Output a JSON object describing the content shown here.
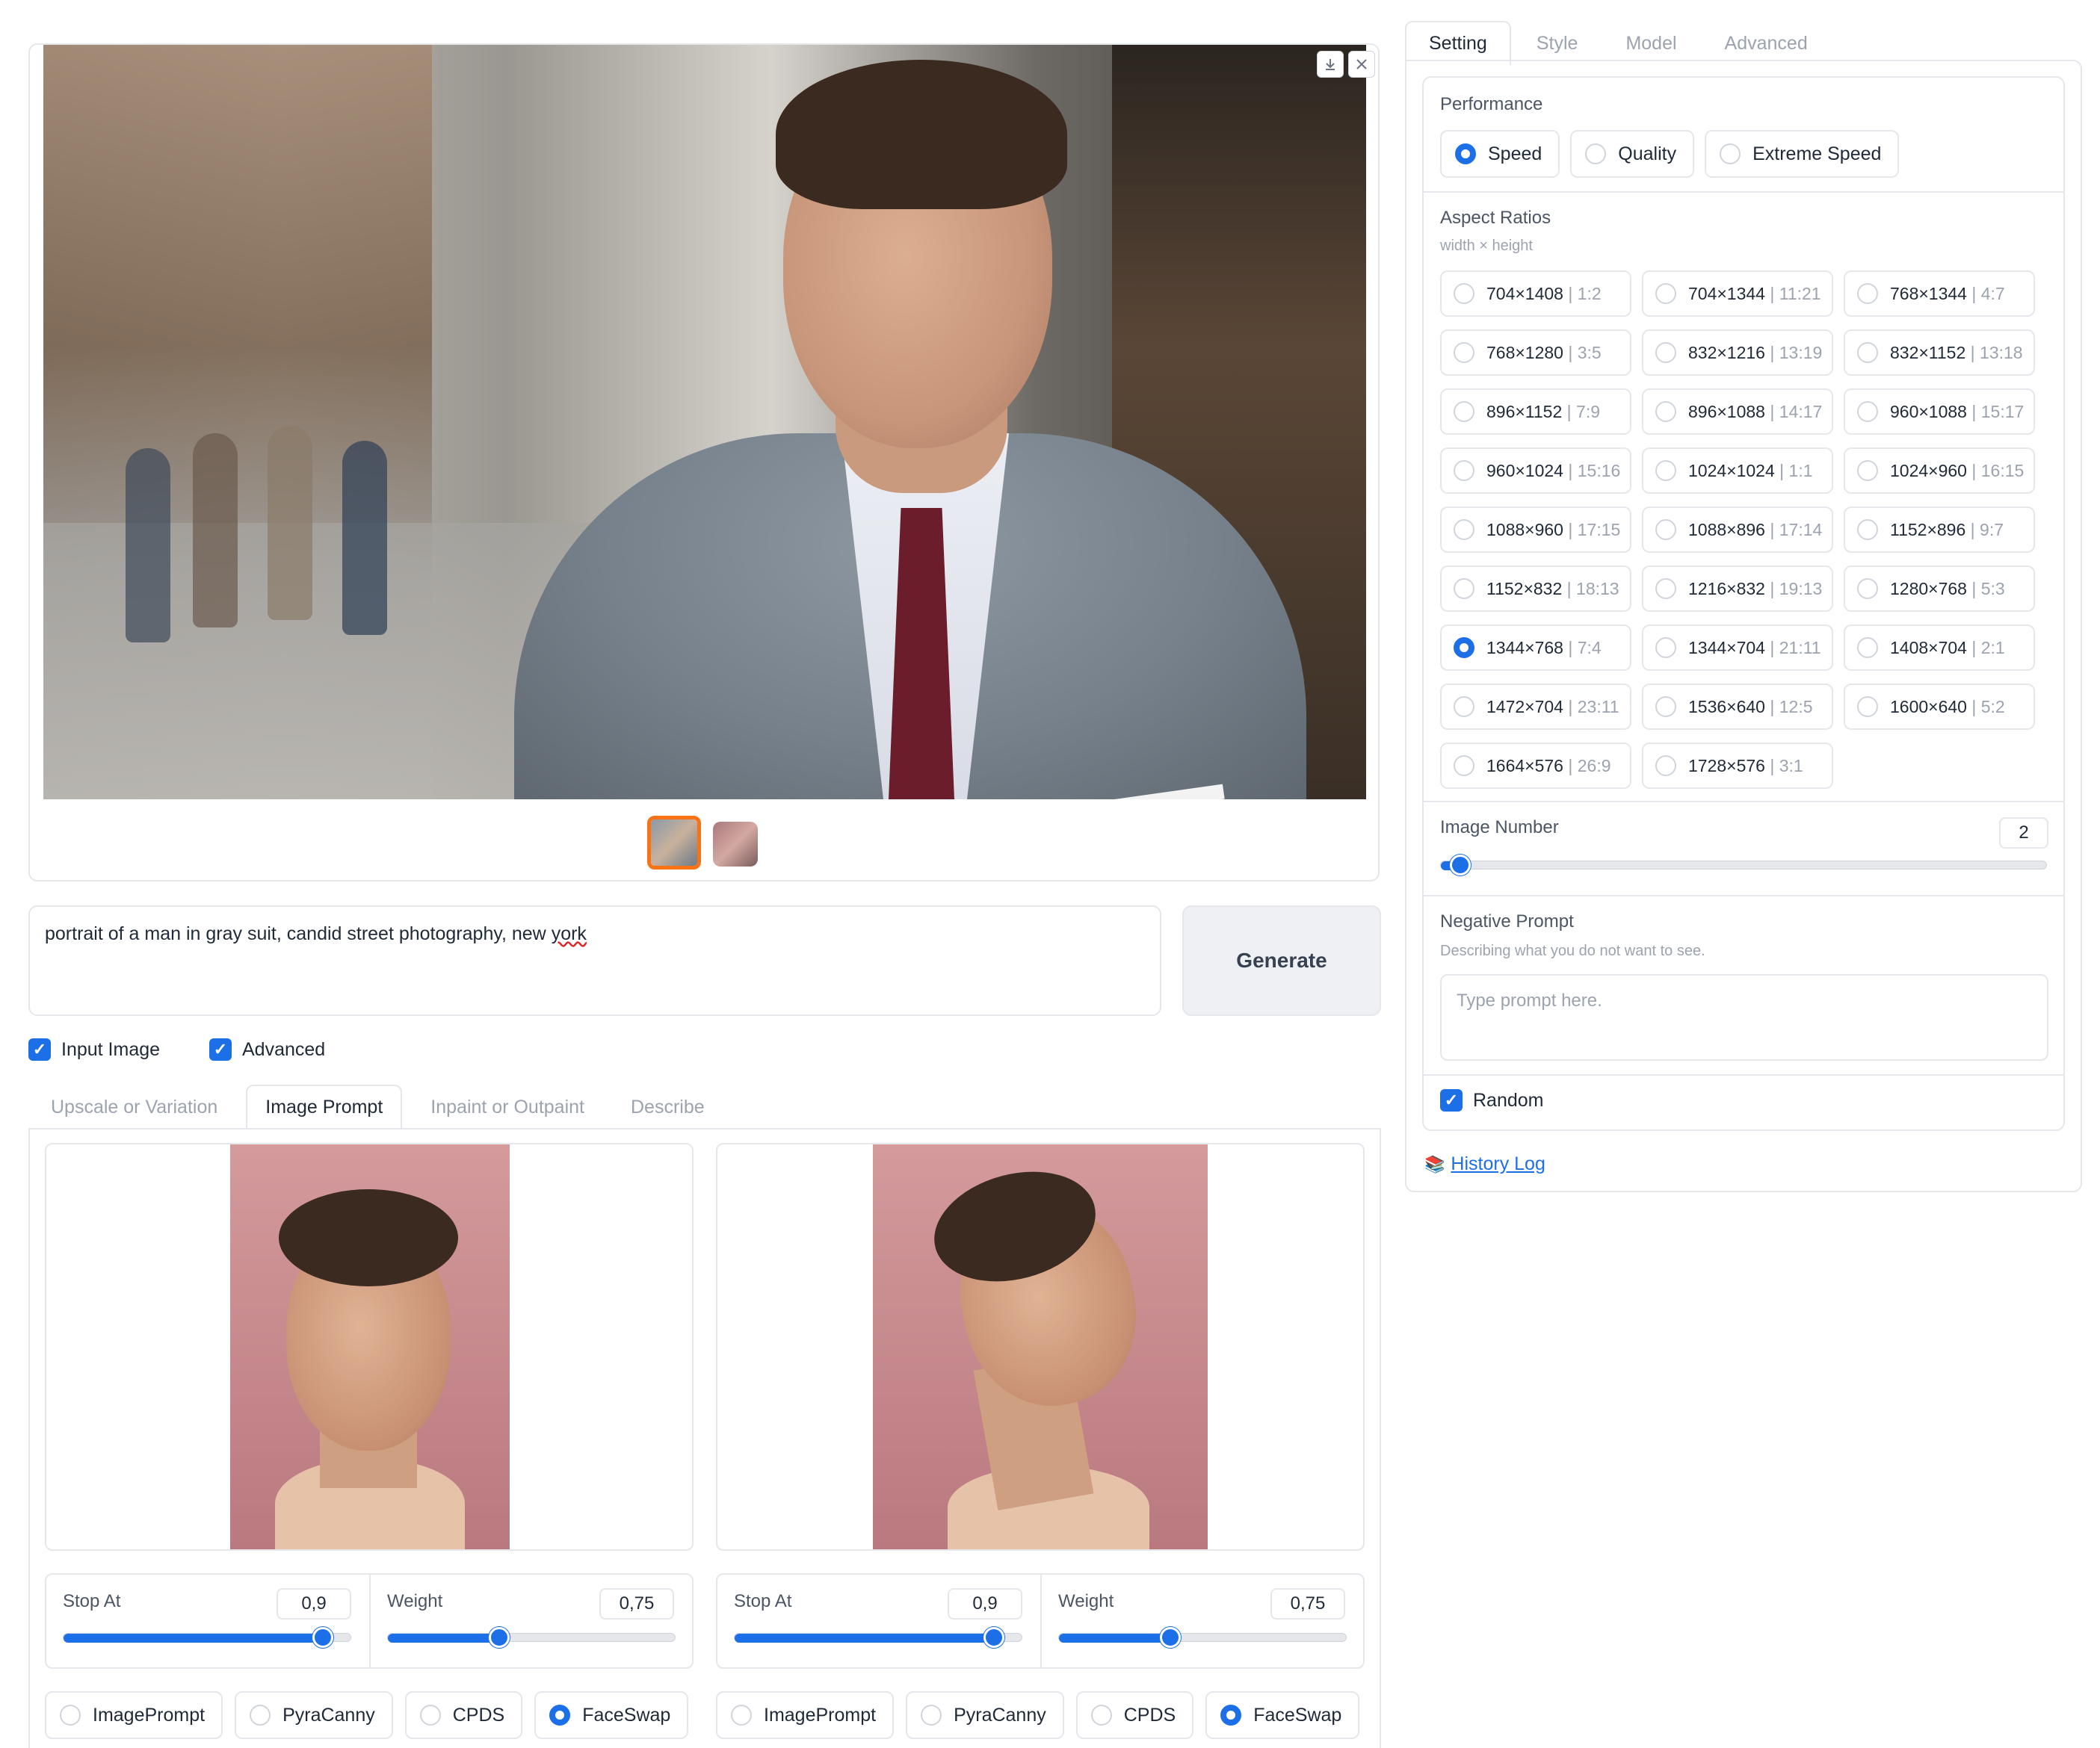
{
  "gallery": {
    "download_icon": "download-icon",
    "close_icon": "close-icon",
    "thumbnails": [
      "thumbnail-1",
      "thumbnail-2"
    ]
  },
  "prompt": {
    "text_before": "portrait of a man in gray suit, candid street photography, new ",
    "text_misspelled": "york",
    "generate_label": "Generate"
  },
  "options": {
    "input_image_label": "Input Image",
    "advanced_label": "Advanced"
  },
  "input_tabs": [
    "Upscale or Variation",
    "Image Prompt",
    "Inpaint or Outpaint",
    "Describe"
  ],
  "image_prompts": [
    {
      "stop_at_label": "Stop At",
      "stop_at_value": "0,9",
      "stop_at_fraction": 0.9,
      "weight_label": "Weight",
      "weight_value": "0,75",
      "weight_fraction": 0.386,
      "types": [
        "ImagePrompt",
        "PyraCanny",
        "CPDS",
        "FaceSwap"
      ],
      "selected": "FaceSwap"
    },
    {
      "stop_at_label": "Stop At",
      "stop_at_value": "0,9",
      "stop_at_fraction": 0.9,
      "weight_label": "Weight",
      "weight_value": "0,75",
      "weight_fraction": 0.386,
      "types": [
        "ImagePrompt",
        "PyraCanny",
        "CPDS",
        "FaceSwap"
      ],
      "selected": "FaceSwap"
    }
  ],
  "settings_tabs": [
    "Setting",
    "Style",
    "Model",
    "Advanced"
  ],
  "performance": {
    "title": "Performance",
    "options": [
      "Speed",
      "Quality",
      "Extreme Speed"
    ],
    "selected": "Speed"
  },
  "aspect_ratios": {
    "title": "Aspect Ratios",
    "subtitle": "width × height",
    "selected": "1344×768",
    "items": [
      {
        "size": "704×1408",
        "ratio": "1:2"
      },
      {
        "size": "704×1344",
        "ratio": "11:21"
      },
      {
        "size": "768×1344",
        "ratio": "4:7"
      },
      {
        "size": "768×1280",
        "ratio": "3:5"
      },
      {
        "size": "832×1216",
        "ratio": "13:19"
      },
      {
        "size": "832×1152",
        "ratio": "13:18"
      },
      {
        "size": "896×1152",
        "ratio": "7:9"
      },
      {
        "size": "896×1088",
        "ratio": "14:17"
      },
      {
        "size": "960×1088",
        "ratio": "15:17"
      },
      {
        "size": "960×1024",
        "ratio": "15:16"
      },
      {
        "size": "1024×1024",
        "ratio": "1:1"
      },
      {
        "size": "1024×960",
        "ratio": "16:15"
      },
      {
        "size": "1088×960",
        "ratio": "17:15"
      },
      {
        "size": "1088×896",
        "ratio": "17:14"
      },
      {
        "size": "1152×896",
        "ratio": "9:7"
      },
      {
        "size": "1152×832",
        "ratio": "18:13"
      },
      {
        "size": "1216×832",
        "ratio": "19:13"
      },
      {
        "size": "1280×768",
        "ratio": "5:3"
      },
      {
        "size": "1344×768",
        "ratio": "7:4"
      },
      {
        "size": "1344×704",
        "ratio": "21:11"
      },
      {
        "size": "1408×704",
        "ratio": "2:1"
      },
      {
        "size": "1472×704",
        "ratio": "23:11"
      },
      {
        "size": "1536×640",
        "ratio": "12:5"
      },
      {
        "size": "1600×640",
        "ratio": "5:2"
      },
      {
        "size": "1664×576",
        "ratio": "26:9"
      },
      {
        "size": "1728×576",
        "ratio": "3:1"
      }
    ]
  },
  "image_number": {
    "label": "Image Number",
    "value": "2",
    "fraction": 0.032
  },
  "negative_prompt": {
    "title": "Negative Prompt",
    "subtitle": "Describing what you do not want to see.",
    "placeholder": "Type prompt here."
  },
  "random": {
    "label": "Random"
  },
  "history_log": {
    "icon": "books-icon",
    "label": "History Log"
  },
  "colors": {
    "accent": "#1d6fe8",
    "thumb_selected": "#f97316"
  }
}
